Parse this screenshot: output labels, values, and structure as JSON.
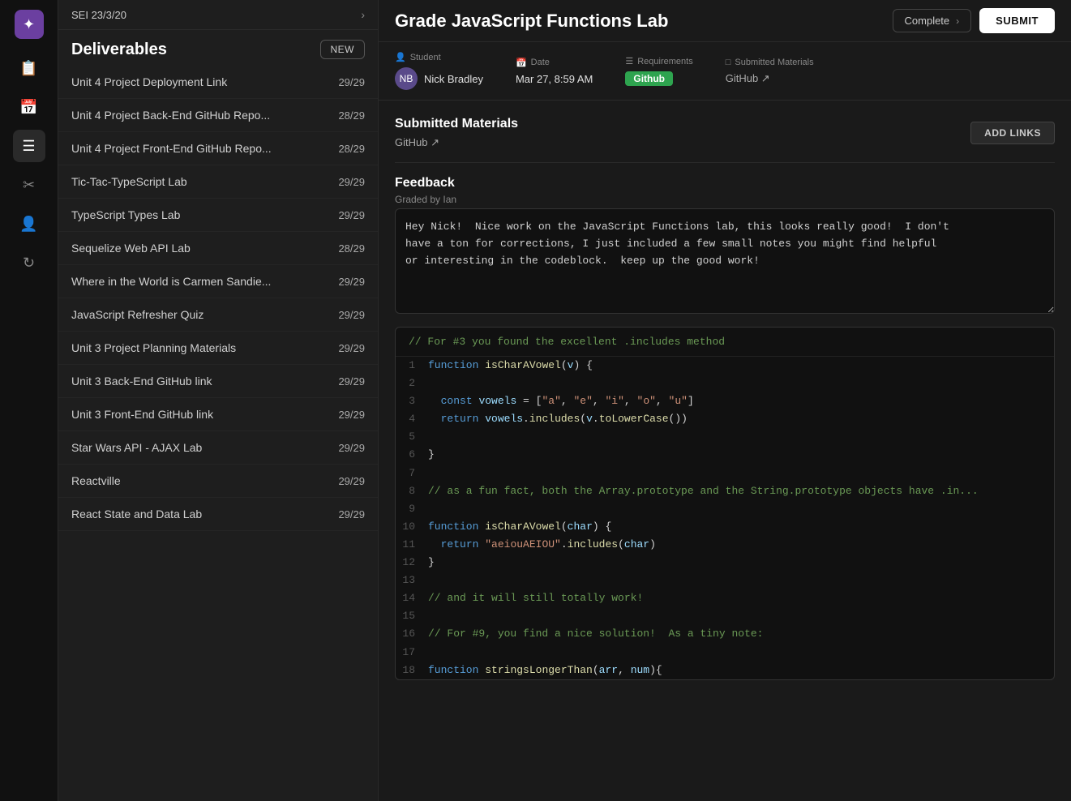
{
  "app": {
    "logo_icon": "✦",
    "icons": [
      {
        "name": "clipboard-icon",
        "glyph": "📋",
        "active": false
      },
      {
        "name": "calendar-icon",
        "glyph": "📅",
        "active": false
      },
      {
        "name": "list-icon",
        "glyph": "☰",
        "active": false
      },
      {
        "name": "tools-icon",
        "glyph": "✂",
        "active": false
      },
      {
        "name": "person-icon",
        "glyph": "👤",
        "active": false
      },
      {
        "name": "refresh-icon",
        "glyph": "↻",
        "active": false
      }
    ]
  },
  "sidebar": {
    "course_label": "SEI 23/3/20",
    "section_title": "Deliverables",
    "new_button_label": "NEW",
    "items": [
      {
        "name": "Unit 4 Project Deployment Link",
        "score": "29/29"
      },
      {
        "name": "Unit 4 Project Back-End GitHub Repo...",
        "score": "28/29"
      },
      {
        "name": "Unit 4 Project Front-End GitHub Repo...",
        "score": "28/29"
      },
      {
        "name": "Tic-Tac-TypeScript Lab",
        "score": "29/29"
      },
      {
        "name": "TypeScript Types Lab",
        "score": "29/29"
      },
      {
        "name": "Sequelize Web API Lab",
        "score": "28/29"
      },
      {
        "name": "Where in the World is Carmen Sandie...",
        "score": "29/29"
      },
      {
        "name": "JavaScript Refresher Quiz",
        "score": "29/29"
      },
      {
        "name": "Unit 3 Project Planning Materials",
        "score": "29/29"
      },
      {
        "name": "Unit 3 Back-End GitHub link",
        "score": "29/29"
      },
      {
        "name": "Unit 3 Front-End GitHub link",
        "score": "29/29"
      },
      {
        "name": "Star Wars API - AJAX Lab",
        "score": "29/29"
      },
      {
        "name": "Reactville",
        "score": "29/29"
      },
      {
        "name": "React State and Data Lab",
        "score": "29/29"
      }
    ]
  },
  "main": {
    "title": "Grade JavaScript Functions Lab",
    "complete_button_label": "Complete",
    "submit_button_label": "SUBMIT",
    "student_label": "Student",
    "date_label": "Date",
    "requirements_label": "Requirements",
    "submitted_materials_label": "Submitted Materials",
    "student_name": "Nick Bradley",
    "date_value": "Mar 27, 8:59 AM",
    "requirements_badge": "Github",
    "github_link_text": "GitHub ↗",
    "submitted_section_title": "Submitted Materials",
    "submitted_github_link": "GitHub ↗",
    "add_links_label": "ADD LINKS",
    "feedback_title": "Feedback",
    "graded_by": "Graded by Ian",
    "feedback_text": "Hey Nick!  Nice work on the JavaScript Functions lab, this looks really good!  I don't\nhave a ton for corrections, I just included a few small notes you might find helpful\nor interesting in the codeblock.  keep up the good work!",
    "code_comment": "// For #3 you found the excellent .includes method",
    "code_lines": [
      {
        "num": 1,
        "content": "function isCharAVowel(v) {"
      },
      {
        "num": 2,
        "content": ""
      },
      {
        "num": 3,
        "content": "  const vowels = [\"a\", \"e\", \"i\", \"o\", \"u\"]"
      },
      {
        "num": 4,
        "content": "  return vowels.includes(v.toLowerCase())"
      },
      {
        "num": 5,
        "content": ""
      },
      {
        "num": 6,
        "content": "}"
      },
      {
        "num": 7,
        "content": ""
      },
      {
        "num": 8,
        "content": "// as a fun fact, both the Array.prototype and the String.prototype objects have .in..."
      },
      {
        "num": 9,
        "content": ""
      },
      {
        "num": 10,
        "content": "function isCharAVowel(char) {"
      },
      {
        "num": 11,
        "content": "  return \"aeiouAEIOU\".includes(char)"
      },
      {
        "num": 12,
        "content": "}"
      },
      {
        "num": 13,
        "content": ""
      },
      {
        "num": 14,
        "content": "// and it will still totally work!"
      },
      {
        "num": 15,
        "content": ""
      },
      {
        "num": 16,
        "content": "// For #9, you find a nice solution!  As a tiny note:"
      },
      {
        "num": 17,
        "content": ""
      },
      {
        "num": 18,
        "content": "function stringsLongerThan(arr, num){"
      }
    ]
  }
}
